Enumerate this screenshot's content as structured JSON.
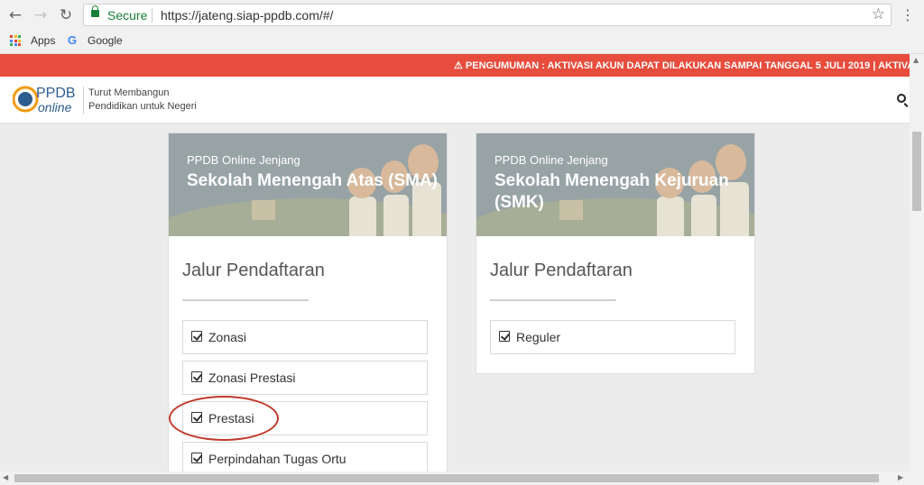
{
  "browser": {
    "secure_label": "Secure",
    "url": "https://jateng.siap-ppdb.com/#/",
    "back_icon": "back-arrow",
    "forward_icon": "forward-arrow",
    "reload_icon": "reload",
    "bookmark_star_icon": "star",
    "bookmarks": [
      {
        "label": "Apps"
      },
      {
        "label": "Google"
      }
    ]
  },
  "announcement": "⚠ PENGUMUMAN : AKTIVASI AKUN DAPAT DILAKUKAN SAMPAI TANGGAL 5 JULI 2019 | AKTIVASI A",
  "header": {
    "logo_text_top": "PPDB",
    "logo_text_bottom": "online",
    "tagline_line1": "Turut Membangun",
    "tagline_line2": "Pendidikan untuk Negeri"
  },
  "cards": [
    {
      "subtitle": "PPDB Online Jenjang",
      "title": "Sekolah Menengah Atas (SMA)",
      "section_title": "Jalur Pendaftaran",
      "options": [
        "Zonasi",
        "Zonasi Prestasi",
        "Prestasi",
        "Perpindahan Tugas Ortu"
      ]
    },
    {
      "subtitle": "PPDB Online Jenjang",
      "title": "Sekolah Menengah Kejuruan (SMK)",
      "section_title": "Jalur Pendaftaran",
      "options": [
        "Reguler"
      ]
    }
  ],
  "colors": {
    "announcement_bg": "#e74c3c",
    "banner_bg": "#98a3a5",
    "annotation_circle": "#c0392b",
    "secure_green": "#188038"
  }
}
